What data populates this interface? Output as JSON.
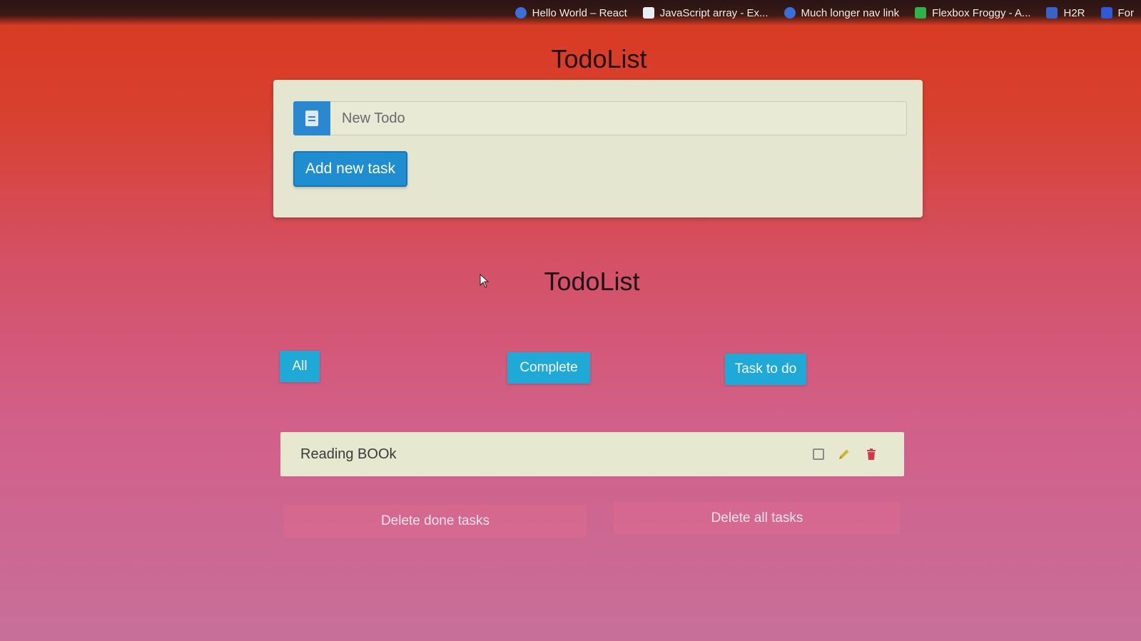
{
  "bookmarks": [
    {
      "label": "Hello World – React",
      "icon": "react-icon"
    },
    {
      "label": "JavaScript array - Ex...",
      "icon": "w3schools-icon"
    },
    {
      "label": "Much longer nav link",
      "icon": "react-icon"
    },
    {
      "label": "Flexbox Froggy - A...",
      "icon": "frog-icon"
    },
    {
      "label": "H2R",
      "icon": "h2r-icon"
    },
    {
      "label": "For",
      "icon": "bookmark-icon"
    }
  ],
  "header": {
    "title": "TodoList"
  },
  "input": {
    "placeholder": "New Todo",
    "icon": "book-icon"
  },
  "add_button": {
    "label": "Add new task"
  },
  "list_section": {
    "title": "TodoList"
  },
  "filters": {
    "all": "All",
    "complete": "Complete",
    "todo": "Task to do"
  },
  "tasks": [
    {
      "text": "Reading BOOk",
      "done": false
    }
  ],
  "actions": {
    "delete_done": "Delete done tasks",
    "delete_all": "Delete all tasks"
  },
  "colors": {
    "primary": "#1f8ed0",
    "filter": "#1ea9d6",
    "card": "#e4e6cf",
    "edit": "#d9b22a",
    "delete": "#d3394c"
  }
}
